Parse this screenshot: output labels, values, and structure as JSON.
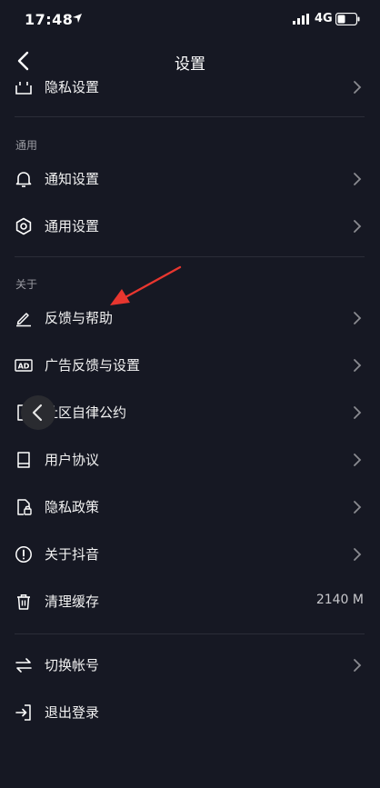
{
  "status": {
    "time": "17:48",
    "network": "4G"
  },
  "nav": {
    "title": "设置"
  },
  "rows": {
    "privacy_settings": "隐私设置",
    "notify_settings": "通知设置",
    "general_settings": "通用设置",
    "feedback_help": "反馈与帮助",
    "ad_feedback": "广告反馈与设置",
    "community": "社区自律公约",
    "user_agreement": "用户协议",
    "privacy_policy": "隐私政策",
    "about": "关于抖音",
    "clear_cache": "清理缓存",
    "cache_size": "2140 M",
    "switch_account": "切换帐号",
    "logout": "退出登录"
  },
  "sections": {
    "general": "通用",
    "about": "关于"
  },
  "colors": {
    "background": "#161823",
    "annotation": "#e8362f",
    "divider": "#2b2d38"
  },
  "icons": {
    "privacy_settings": "privacy-icon",
    "notify_settings": "bell-icon",
    "general_settings": "gear-icon",
    "feedback_help": "pencil-icon",
    "ad_feedback": "ad-icon",
    "community": "document-icon",
    "user_agreement": "book-icon",
    "privacy_policy": "lock-document-icon",
    "about": "info-icon",
    "clear_cache": "trash-icon",
    "switch_account": "swap-icon",
    "logout": "logout-icon"
  }
}
